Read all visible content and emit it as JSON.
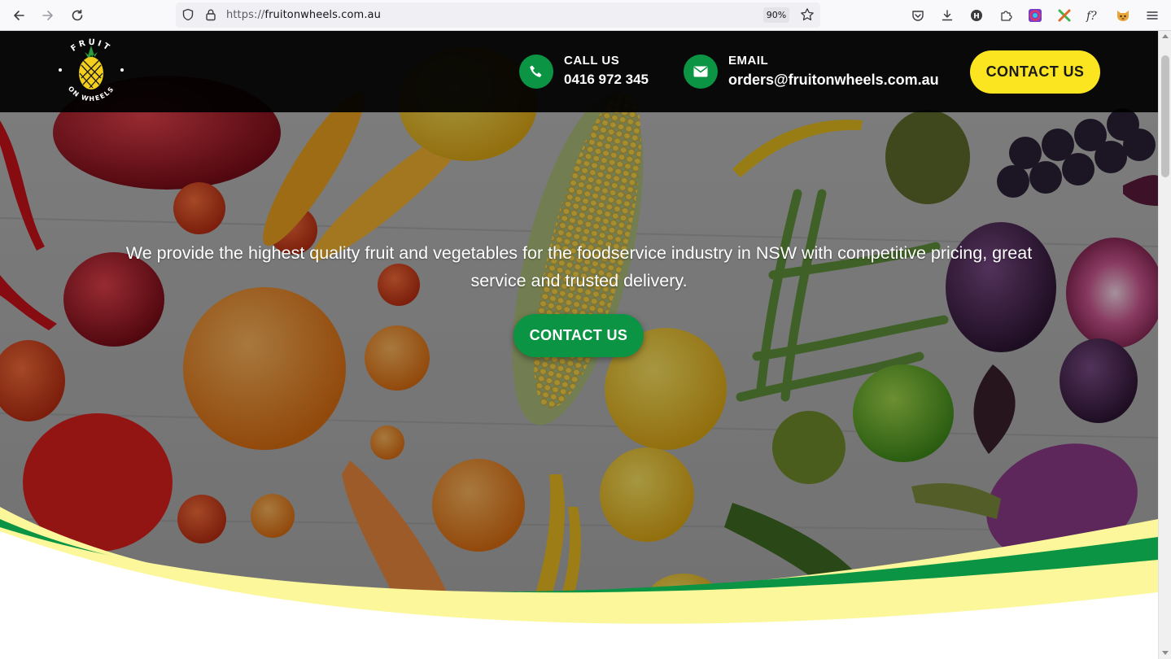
{
  "browser": {
    "url_scheme": "https://",
    "url_domain": "fruitonwheels.com.au",
    "zoom": "90%",
    "icons": [
      "back-arrow-icon",
      "forward-arrow-icon",
      "reload-icon",
      "shield-icon",
      "lock-icon",
      "bookmark-star-icon",
      "pocket-icon",
      "download-icon",
      "h-extension-icon",
      "extensions-puzzle-icon",
      "color-picker-extension-icon",
      "x-extension-icon",
      "font-finder-extension-icon",
      "fox-extension-icon",
      "menu-hamburger-icon"
    ]
  },
  "header": {
    "logo_text_top": "FRUIT",
    "logo_text_bottom": "ON WHEELS",
    "call": {
      "label": "CALL US",
      "value": "0416 972 345",
      "icon": "phone-icon"
    },
    "email": {
      "label": "EMAIL",
      "value": "orders@fruitonwheels.com.au",
      "icon": "envelope-icon"
    },
    "cta_label": "CONTACT US"
  },
  "hero": {
    "tagline": "We provide the highest quality fruit and vegetables for the foodservice industry in NSW with competitive pricing, great service and trusted delivery.",
    "cta_label": "CONTACT US"
  },
  "colors": {
    "brand_green": "#0b9444",
    "brand_yellow": "#fbe521",
    "wave_light_yellow": "#fbf79a",
    "header_bg": "#000000"
  }
}
